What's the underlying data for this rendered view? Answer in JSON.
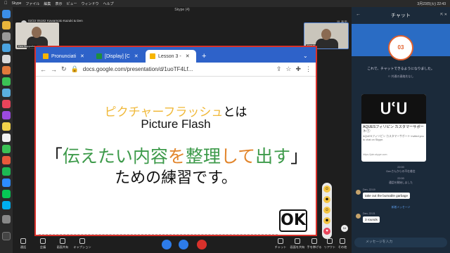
{
  "menubar": {
    "app": "Skype",
    "items": [
      "ファイル",
      "編集",
      "表示",
      "ビュー",
      "ウィンドウ",
      "ヘルプ"
    ],
    "datetime": "3月23日(火) 22:43"
  },
  "call": {
    "window_title": "Skype (4)",
    "conversation": "02/22 05182 Kawamoto Kazuki & Den",
    "participants": "2人が参加中 | 40:49",
    "view_label": "表示",
    "self_label": "Den Supporter",
    "remote_label": "Kazuki"
  },
  "browser": {
    "tabs": [
      {
        "label": "Pronunciati",
        "color": "#f7b500"
      },
      {
        "label": "[Display] [C",
        "color": "#1e8e3e"
      },
      {
        "label": "Lesson 3 - ",
        "color": "#f7b500"
      }
    ],
    "url": "docs.google.com/presentation/d/1uoTF4Lf..."
  },
  "slide": {
    "line1_katakana": "ピクチャーフラッシュ",
    "line1_suffix": "とは",
    "line2": "Picture Flash",
    "line3_open": "「",
    "line3_a": "伝えたい",
    "line3_b": "内容",
    "line3_c": "を",
    "line3_d": "整理",
    "line3_e": "して",
    "line3_f": "出す",
    "line3_close": "」",
    "line4": "ための練習です。",
    "ok": "OK"
  },
  "reactions": [
    "☺",
    "☻",
    "☺",
    "☻",
    "♥"
  ],
  "speed": "1x",
  "toolbar": {
    "left": [
      "通話",
      "会議",
      "画面共有",
      "キャプション"
    ],
    "right": [
      "チャット",
      "画面を共有",
      "手を挙げる",
      "リアクト",
      "その他"
    ]
  },
  "chat": {
    "title": "チャット",
    "badge": "03",
    "intro": "これで、チャットできるようになりました。",
    "shared_contacts": "共通の連絡先なし",
    "card_logo": "ՍՙՍ",
    "card_title": "AQUESフィリピン カスタマーサポート①",
    "card_desc": "AQUESフィリピン カスタマーサポート Invited you to chat on Skype.",
    "card_url": "https://join.skype.com",
    "sys1_time": "22:00",
    "sys1": "Denさんからの不在着信",
    "sys2_time": "22:00",
    "sys2": "通話を開始しました",
    "msg1_sender": "Den, 22:19",
    "msg1": "take out the bumable garbage",
    "new_messages": "新着メッセージ",
    "msg2_sender": "Den, 22:21",
    "msg2": "3 rounds",
    "input_placeholder": "メッセージを入力"
  }
}
